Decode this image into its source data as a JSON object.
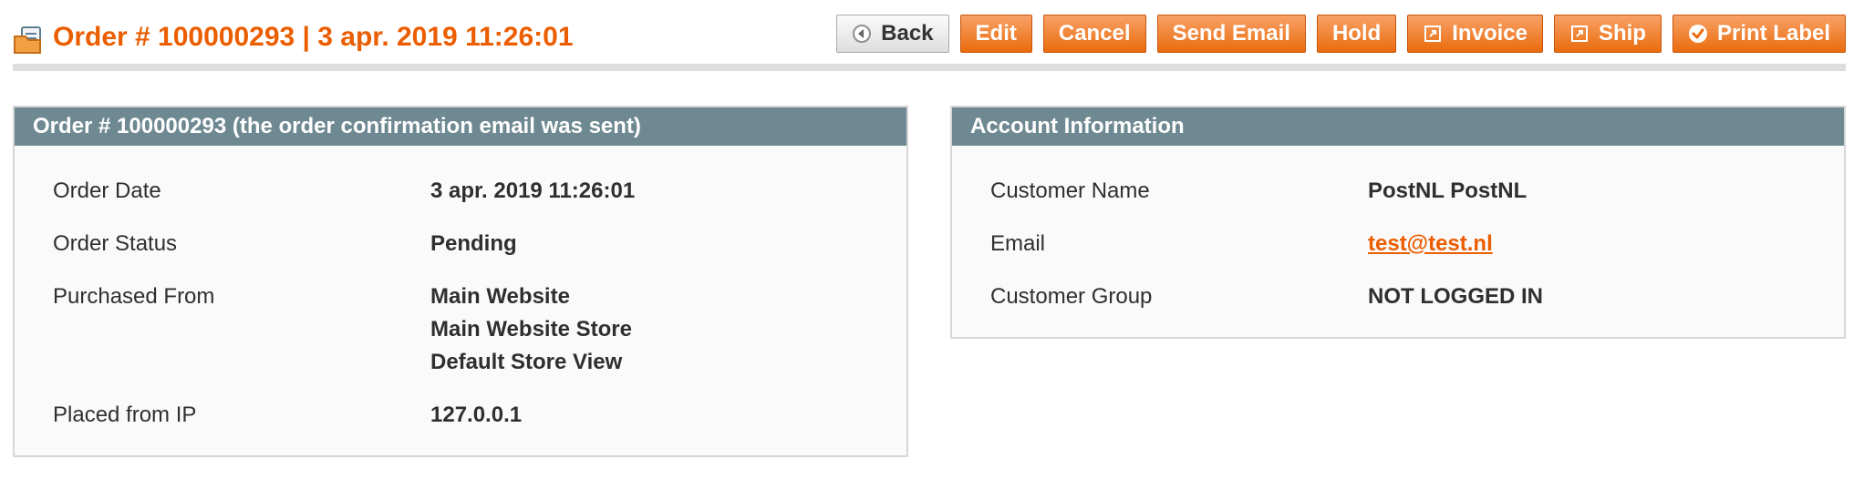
{
  "header": {
    "title": "Order # 100000293 | 3 apr. 2019 11:26:01",
    "buttons": {
      "back": "Back",
      "edit": "Edit",
      "cancel": "Cancel",
      "send_email": "Send Email",
      "hold": "Hold",
      "invoice": "Invoice",
      "ship": "Ship",
      "print_label": "Print Label"
    },
    "icons": {
      "title": "order-view-icon",
      "back": "back-arrow-icon",
      "invoice": "invoice-icon",
      "ship": "ship-icon",
      "print_label": "checkmark-circle-icon"
    }
  },
  "order_panel": {
    "title": "Order # 100000293 (the order confirmation email was sent)",
    "rows": {
      "order_date": {
        "label": "Order Date",
        "value": "3 apr. 2019 11:26:01"
      },
      "order_status": {
        "label": "Order Status",
        "value": "Pending"
      },
      "purchased_from": {
        "label": "Purchased From",
        "values": [
          "Main Website",
          "Main Website Store",
          "Default Store View"
        ]
      },
      "placed_from_ip": {
        "label": "Placed from IP",
        "value": "127.0.0.1"
      }
    }
  },
  "account_panel": {
    "title": "Account Information",
    "rows": {
      "customer_name": {
        "label": "Customer Name",
        "value": "PostNL PostNL"
      },
      "email": {
        "label": "Email",
        "value": "test@test.nl"
      },
      "customer_group": {
        "label": "Customer Group",
        "value": "NOT LOGGED IN"
      }
    }
  },
  "colors": {
    "accent": "#eb5e00",
    "button_orange": "#ea6c0c",
    "panel_header": "#6f8992",
    "panel_background": "#fafafa",
    "border": "#d6d6d6",
    "divider": "#dddddd"
  }
}
